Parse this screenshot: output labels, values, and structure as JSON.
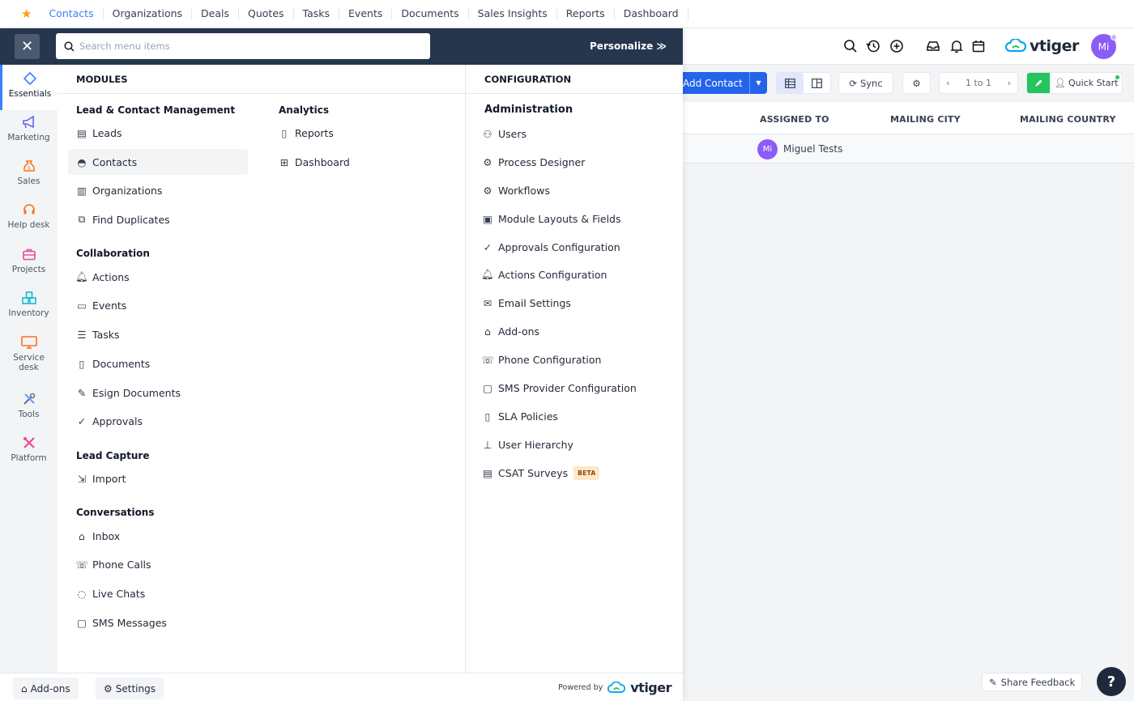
{
  "topnav": {
    "tabs": [
      "Contacts",
      "Organizations",
      "Deals",
      "Quotes",
      "Tasks",
      "Events",
      "Documents",
      "Sales Insights",
      "Reports",
      "Dashboard"
    ],
    "active": "Contacts"
  },
  "header": {
    "brand": "vtiger",
    "avatar": "Mi"
  },
  "toolbar": {
    "add_contact": "Add Contact",
    "sync": "Sync",
    "pager": "1 to 1",
    "quick_start": "Quick Start"
  },
  "table": {
    "columns": [
      "ASSIGNED TO",
      "MAILING CITY",
      "MAILING COUNTRY"
    ],
    "row": {
      "avatar": "Mi",
      "assigned_to": "Miguel Tests"
    }
  },
  "menu": {
    "search_placeholder": "Search menu items",
    "personalize": "Personalize",
    "rail": [
      {
        "label": "Essentials",
        "icon": "diamond-icon",
        "color": "#3b82f6"
      },
      {
        "label": "Marketing",
        "icon": "megaphone-icon",
        "color": "#6366f1"
      },
      {
        "label": "Sales",
        "icon": "money-bag-icon",
        "color": "#f97316"
      },
      {
        "label": "Help desk",
        "icon": "headset-icon",
        "color": "#f97316"
      },
      {
        "label": "Projects",
        "icon": "briefcase-icon",
        "color": "#ec4899"
      },
      {
        "label": "Inventory",
        "icon": "boxes-icon",
        "color": "#06b6d4"
      },
      {
        "label": "Service desk",
        "icon": "monitor-icon",
        "color": "#f97316"
      },
      {
        "label": "Tools",
        "icon": "tools-icon",
        "color": "#64748b"
      },
      {
        "label": "Platform",
        "icon": "platform-icon",
        "color": "#ec4899"
      }
    ],
    "modules_heading": "MODULES",
    "configuration_heading": "CONFIGURATION",
    "lead_contact": {
      "heading": "Lead & Contact Management",
      "items": [
        "Leads",
        "Contacts",
        "Organizations",
        "Find Duplicates"
      ]
    },
    "collaboration": {
      "heading": "Collaboration",
      "items": [
        "Actions",
        "Events",
        "Tasks",
        "Documents",
        "Esign Documents",
        "Approvals"
      ]
    },
    "lead_capture": {
      "heading": "Lead Capture",
      "items": [
        "Import"
      ]
    },
    "conversations": {
      "heading": "Conversations",
      "items": [
        "Inbox",
        "Phone Calls",
        "Live Chats",
        "SMS Messages"
      ]
    },
    "analytics": {
      "heading": "Analytics",
      "items": [
        "Reports",
        "Dashboard"
      ]
    },
    "administration": {
      "heading": "Administration",
      "items": [
        "Users",
        "Process Designer",
        "Workflows",
        "Module Layouts & Fields",
        "Approvals Configuration",
        "Actions Configuration",
        "Email Settings",
        "Add-ons",
        "Phone Configuration",
        "SMS Provider Configuration",
        "SLA Policies",
        "User Hierarchy",
        "CSAT Surveys"
      ],
      "beta": "BETA"
    },
    "footer": {
      "addons": "Add-ons",
      "settings": "Settings",
      "powered_by": "Powered by",
      "brand": "vtiger"
    }
  },
  "feedback": "Share Feedback",
  "help": "?"
}
